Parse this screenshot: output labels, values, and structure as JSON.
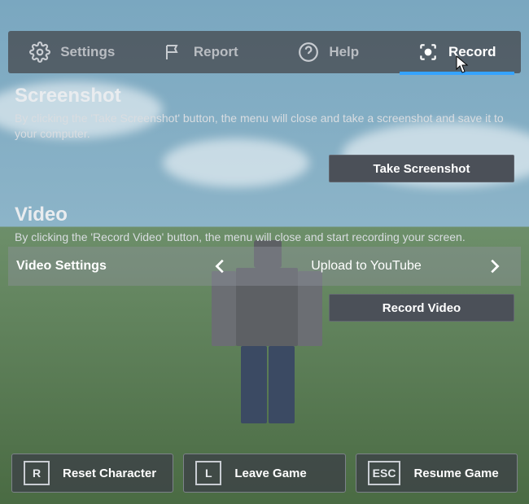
{
  "tabs": {
    "settings": "Settings",
    "report": "Report",
    "help": "Help",
    "record": "Record"
  },
  "screenshot": {
    "title": "Screenshot",
    "desc": "By clicking the 'Take Screenshot' button, the menu will close and take a screenshot and save it to your computer.",
    "button": "Take Screenshot"
  },
  "video": {
    "title": "Video",
    "desc": "By clicking the 'Record Video' button, the menu will close and start recording your screen.",
    "settings_label": "Video Settings",
    "settings_value": "Upload to YouTube",
    "button": "Record Video"
  },
  "bottom": {
    "reset_key": "R",
    "reset_label": "Reset Character",
    "leave_key": "L",
    "leave_label": "Leave Game",
    "resume_key": "ESC",
    "resume_label": "Resume Game"
  }
}
